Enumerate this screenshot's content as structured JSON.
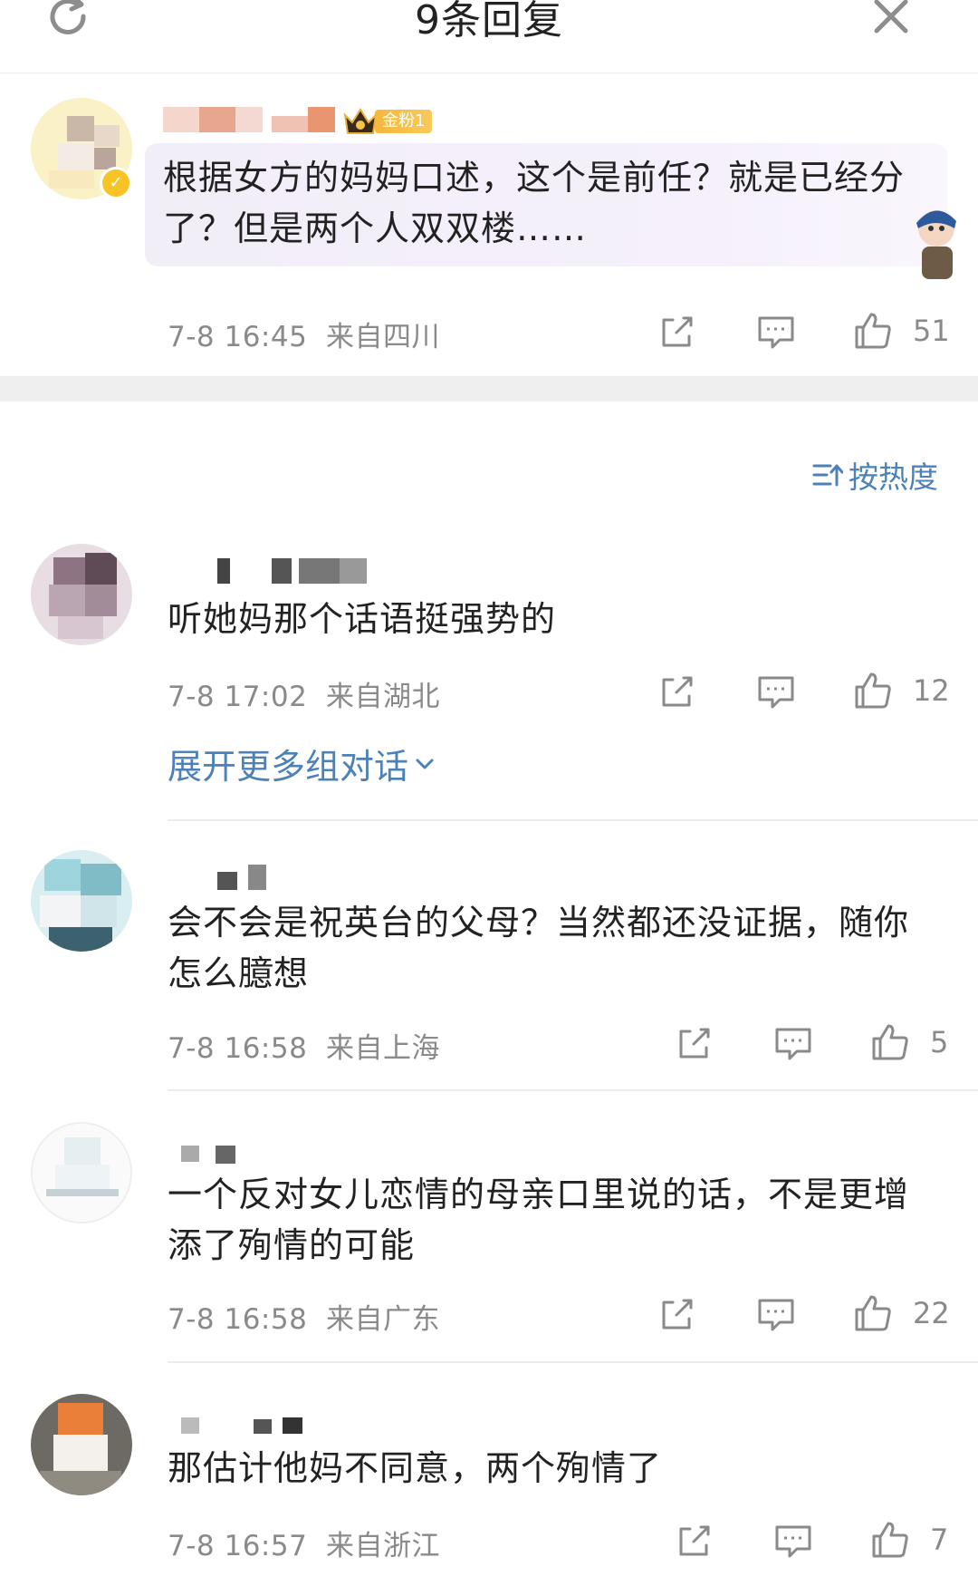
{
  "header": {
    "title": "9条回复"
  },
  "main_comment": {
    "fan_badge": "金粉1",
    "text": "根据女方的妈妈口述，这个是前任？就是已经分了？但是两个人双双楼……",
    "time": "7-8 16:45",
    "location": "来自四川",
    "likes": "51"
  },
  "sort_label": "按热度",
  "replies": [
    {
      "text": "听她妈那个话语挺强势的",
      "time": "7-8 17:02",
      "location": "来自湖北",
      "likes": "12"
    },
    {
      "text": "会不会是祝英台的父母？当然都还没证据，随你怎么臆想",
      "time": "7-8 16:58",
      "location": "来自上海",
      "likes": "5"
    },
    {
      "text": "一个反对女儿恋情的母亲口里说的话，不是更增添了殉情的可能",
      "time": "7-8 16:58",
      "location": "来自广东",
      "likes": "22"
    },
    {
      "text": "那估计他妈不同意，两个殉情了",
      "time": "7-8 16:57",
      "location": "来自浙江",
      "likes": "7"
    }
  ],
  "expand_label": "展开更多组对话",
  "icons": {
    "refresh": "refresh-icon",
    "close": "close-icon",
    "share": "share-icon",
    "comment": "comment-icon",
    "like": "thumbs-up-icon",
    "sort": "sort-icon",
    "crown": "crown-icon"
  },
  "colors": {
    "link_blue": "#4c82b8",
    "meta_gray": "#8a8a8a",
    "badge_gold": "#f6b73c"
  }
}
